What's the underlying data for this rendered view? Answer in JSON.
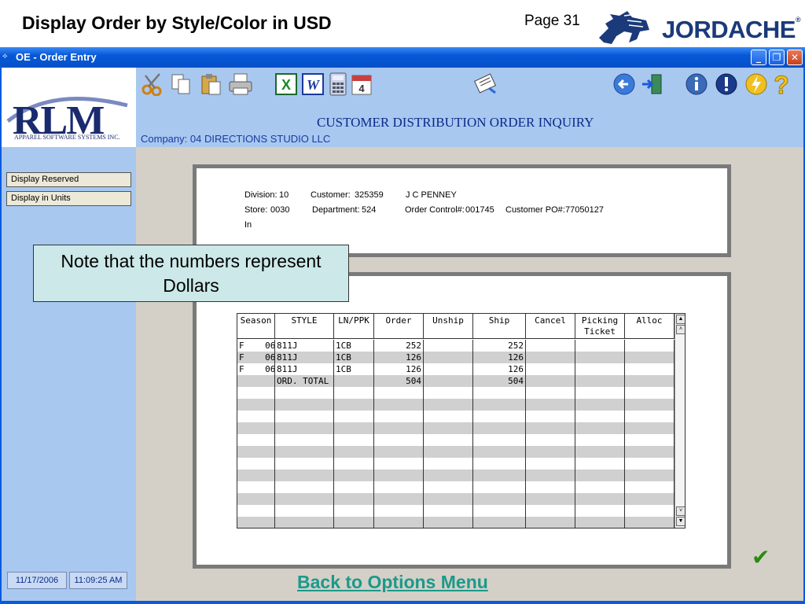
{
  "slide": {
    "title": "Display Order by Style/Color in USD",
    "page": "Page 31",
    "brand": "JORDACHE",
    "brand_mark": "®",
    "link": "Back to Options Menu",
    "callout": "Note that the numbers represent Dollars"
  },
  "window": {
    "title": "OE - Order Entry",
    "controls": [
      "_",
      "❐",
      "✕"
    ]
  },
  "logo": {
    "name": "RLM",
    "sub": "APPAREL SOFTWARE SYSTEMS INC."
  },
  "header": {
    "screen_title": "CUSTOMER DISTRIBUTION ORDER INQUIRY",
    "company_label": "Company:",
    "company_value": "04  DIRECTIONS STUDIO LLC"
  },
  "toolbar_icons": [
    "scissors-icon",
    "copy-icon",
    "paste-icon",
    "print-icon",
    "excel-icon",
    "word-icon",
    "calculator-icon",
    "calendar-icon",
    "document-edit-icon",
    "back-arrow-icon",
    "exit-door-icon",
    "info-icon",
    "alert-icon",
    "lightning-icon",
    "help-icon"
  ],
  "sidebar": {
    "buttons": [
      "Display Reserved",
      "Display in Units"
    ],
    "date": "11/17/2006",
    "time": "11:09:25 AM"
  },
  "order": {
    "division_label": "Division:",
    "division": "10",
    "customer_label": "Customer:",
    "customer": "325359",
    "customer_name": "J C PENNEY",
    "store_label": "Store:",
    "store": "0030",
    "department_label": "Department:",
    "department": "524",
    "control_label": "Order Control#:",
    "control": "001745",
    "po_label": "Customer PO#:",
    "po": "77050127",
    "extra": "In"
  },
  "grid": {
    "columns": [
      "Season",
      "STYLE",
      "LN/PPK",
      "Order",
      "Unship",
      "Ship",
      "Cancel",
      "Picking\nTicket",
      "Alloc"
    ],
    "rows": [
      [
        "F    06",
        "811J",
        "1CB",
        "252",
        "",
        "252",
        "",
        "",
        ""
      ],
      [
        "F    06",
        "811J",
        "1CB",
        "126",
        "",
        "126",
        "",
        "",
        ""
      ],
      [
        "F    06",
        "811J",
        "1CB",
        "126",
        "",
        "126",
        "",
        "",
        ""
      ],
      [
        "",
        "ORD. TOTAL",
        "",
        "504",
        "",
        "504",
        "",
        "",
        ""
      ]
    ],
    "empty_rows": 12
  },
  "colors": {
    "titlebar": "#0a5ade",
    "panel": "#a8c8f0",
    "callout": "#cce8e8",
    "link": "#1a9a8a"
  }
}
